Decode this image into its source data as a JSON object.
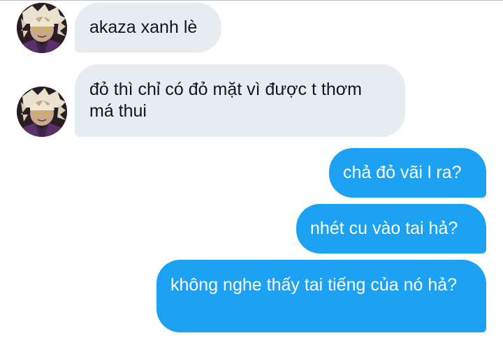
{
  "conversation": {
    "messages": [
      {
        "direction": "received",
        "text": "akaza xanh lè"
      },
      {
        "direction": "received",
        "text": "đỏ thì chỉ có đỏ mặt vì được t thơm má thui"
      },
      {
        "direction": "sent",
        "text": "chả đỏ vãi l ra?"
      },
      {
        "direction": "sent",
        "text": "nhét cu vào tai hả?"
      },
      {
        "direction": "sent",
        "text": "không nghe thấy tai tiếng của nó hả?"
      }
    ]
  },
  "colors": {
    "received_bubble": "#e6ecf0",
    "received_text": "#14171a",
    "sent_bubble": "#1da1f2",
    "sent_text": "#ffffff"
  }
}
